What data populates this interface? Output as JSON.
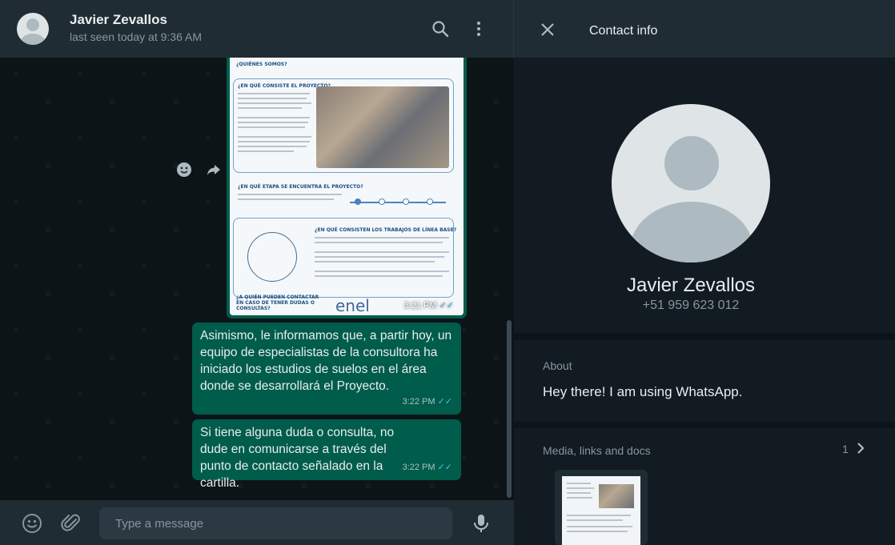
{
  "chat": {
    "contact_name": "Javier Zevallos",
    "last_seen": "last seen today at 9:36 AM",
    "image_message": {
      "time": "3:21 PM",
      "doc_titles": [
        "¿QUIÉNES SOMOS?",
        "¿EN QUÉ CONSISTE EL PROYECTO?",
        "¿EN QUÉ ETAPA SE ENCUENTRA EL PROYECTO?",
        "¿EN QUÉ CONSISTEN LOS TRABAJOS DE LÍNEA BASE?",
        "¿A QUIÉN PUEDEN CONTACTAR EN CASO DE TENER DUDAS O CONSULTAS?"
      ],
      "doc_brand": "enel"
    },
    "messages": [
      {
        "text": "Asimismo, le informamos que, a partir hoy, un equipo de especialistas de la consultora ha iniciado los estudios de suelos en el área donde se desarrollará el Proyecto.",
        "time": "3:22 PM"
      },
      {
        "text": "Si tiene alguna duda o consulta, no dude en comunicarse a través del punto de contacto señalado en la cartilla.",
        "time": "3:22 PM"
      }
    ],
    "composer_placeholder": "Type a message"
  },
  "info": {
    "title": "Contact info",
    "name": "Javier Zevallos",
    "phone": "+51 959 623 012",
    "about_label": "About",
    "about_text": "Hey there! I am using WhatsApp.",
    "media_label": "Media, links and docs",
    "media_count": "1"
  },
  "icons": [
    "search-icon",
    "menu-icon",
    "emoji-icon",
    "attach-icon",
    "mic-icon",
    "close-icon",
    "chevron-right-icon",
    "forward-icon",
    "double-check-icon"
  ],
  "colors": {
    "header_bg": "#202c33",
    "outgoing_bubble": "#005c4b",
    "panel_bg": "#111b21",
    "read_tick": "#53bdeb",
    "secondary_text": "#8696a0"
  }
}
